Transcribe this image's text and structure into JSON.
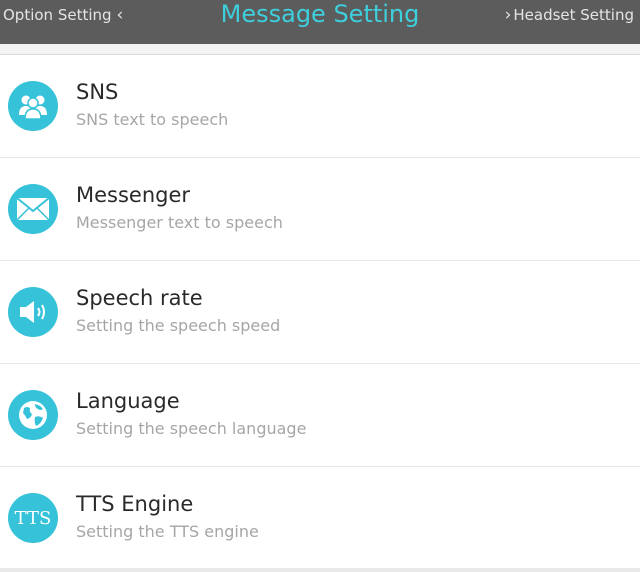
{
  "header": {
    "back_label": "Option Setting",
    "title": "Message Setting",
    "forward_label": "Headset Setting",
    "accent_color": "#3ecfdc",
    "bar_color": "#5c5c5c"
  },
  "items": [
    {
      "title": "SNS",
      "subtitle": "SNS text to speech",
      "icon": "people-icon"
    },
    {
      "title": "Messenger",
      "subtitle": "Messenger text to speech",
      "icon": "envelope-icon"
    },
    {
      "title": "Speech rate",
      "subtitle": "Setting the speech speed",
      "icon": "speaker-icon"
    },
    {
      "title": "Language",
      "subtitle": "Setting the speech language",
      "icon": "globe-icon"
    },
    {
      "title": "TTS Engine",
      "subtitle": "Setting the TTS engine",
      "icon": "tts-icon",
      "icon_text": "TTS"
    }
  ],
  "icon_color": "#36c2d8"
}
